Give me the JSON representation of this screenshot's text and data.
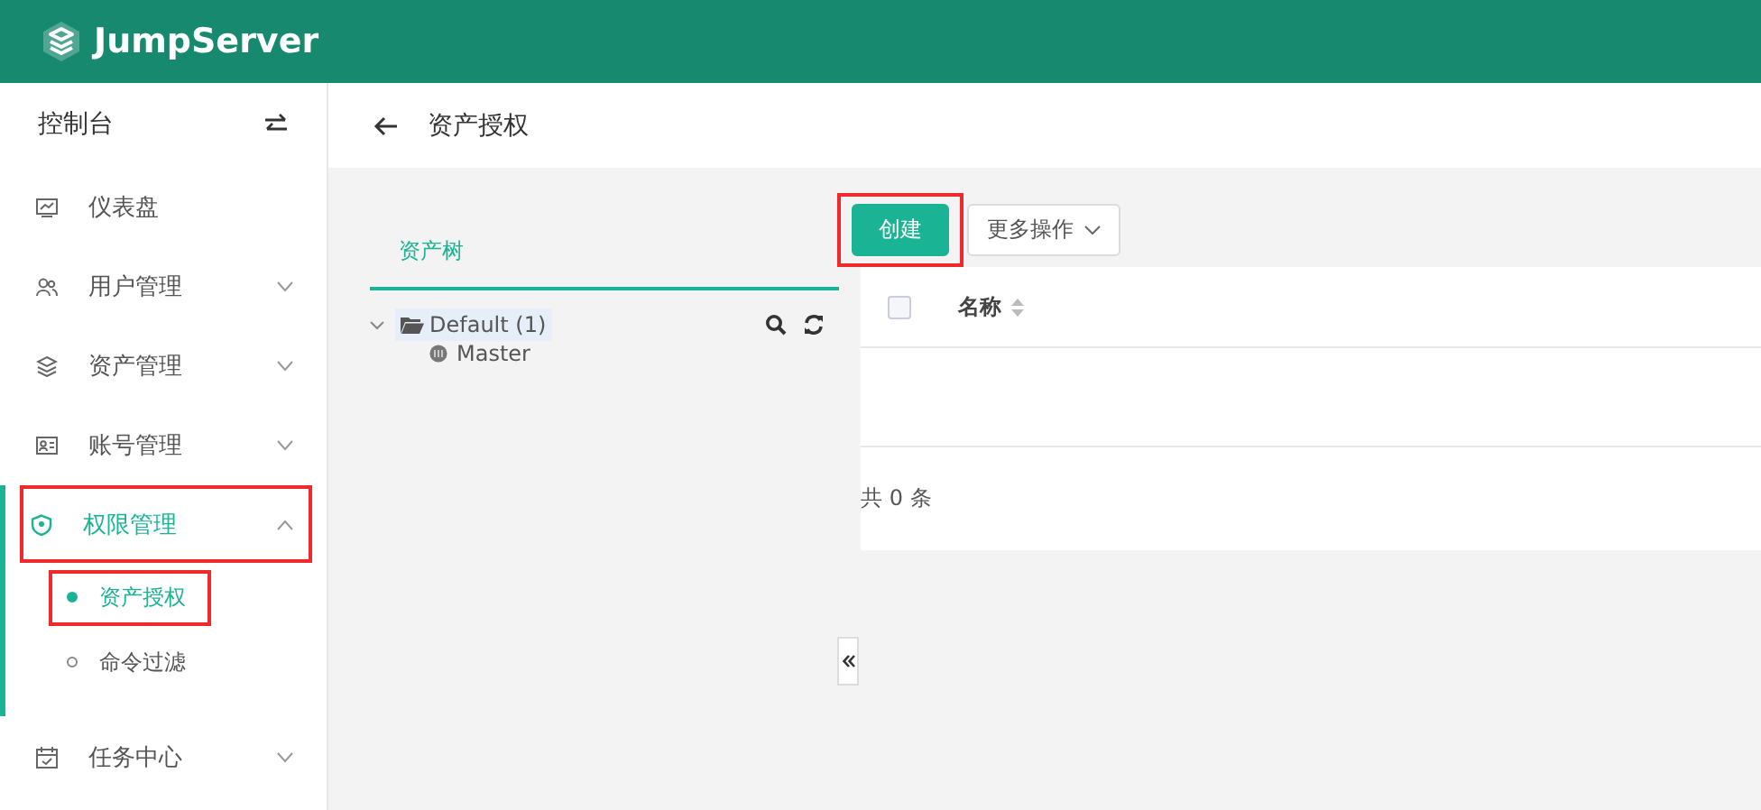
{
  "header": {
    "brand": "JumpServer"
  },
  "sidebar": {
    "title": "控制台",
    "items": [
      {
        "label": "仪表盘",
        "selected": false,
        "highlighted": false
      },
      {
        "label": "用户管理",
        "expanded": false,
        "selected": false,
        "highlighted": false
      },
      {
        "label": "资产管理",
        "expanded": false,
        "selected": false,
        "highlighted": false
      },
      {
        "label": "账号管理",
        "expanded": false,
        "selected": false,
        "highlighted": false
      },
      {
        "label": "权限管理",
        "expanded": true,
        "selected": true,
        "highlighted": true,
        "children": [
          {
            "label": "资产授权",
            "selected": true,
            "highlighted": true
          },
          {
            "label": "命令过滤",
            "selected": false,
            "highlighted": false
          }
        ]
      },
      {
        "label": "任务中心",
        "expanded": false,
        "selected": false,
        "highlighted": false
      }
    ]
  },
  "page": {
    "title": "资产授权"
  },
  "tree_panel": {
    "tabs": [
      {
        "label": "资产树",
        "selected": true
      }
    ],
    "nodes": [
      {
        "label": "Default (1)",
        "expanded": true,
        "selected": true,
        "children": [
          {
            "label": "Master"
          }
        ]
      }
    ]
  },
  "toolbar": [
    {
      "label": "创建",
      "kind": "primary",
      "highlighted": true
    },
    {
      "label": "更多操作",
      "kind": "dropdown",
      "highlighted": false
    }
  ],
  "table": {
    "select_all_checked": false,
    "columns": [
      {
        "label": "名称",
        "sortable": true
      }
    ],
    "total": "共 0 条"
  }
}
